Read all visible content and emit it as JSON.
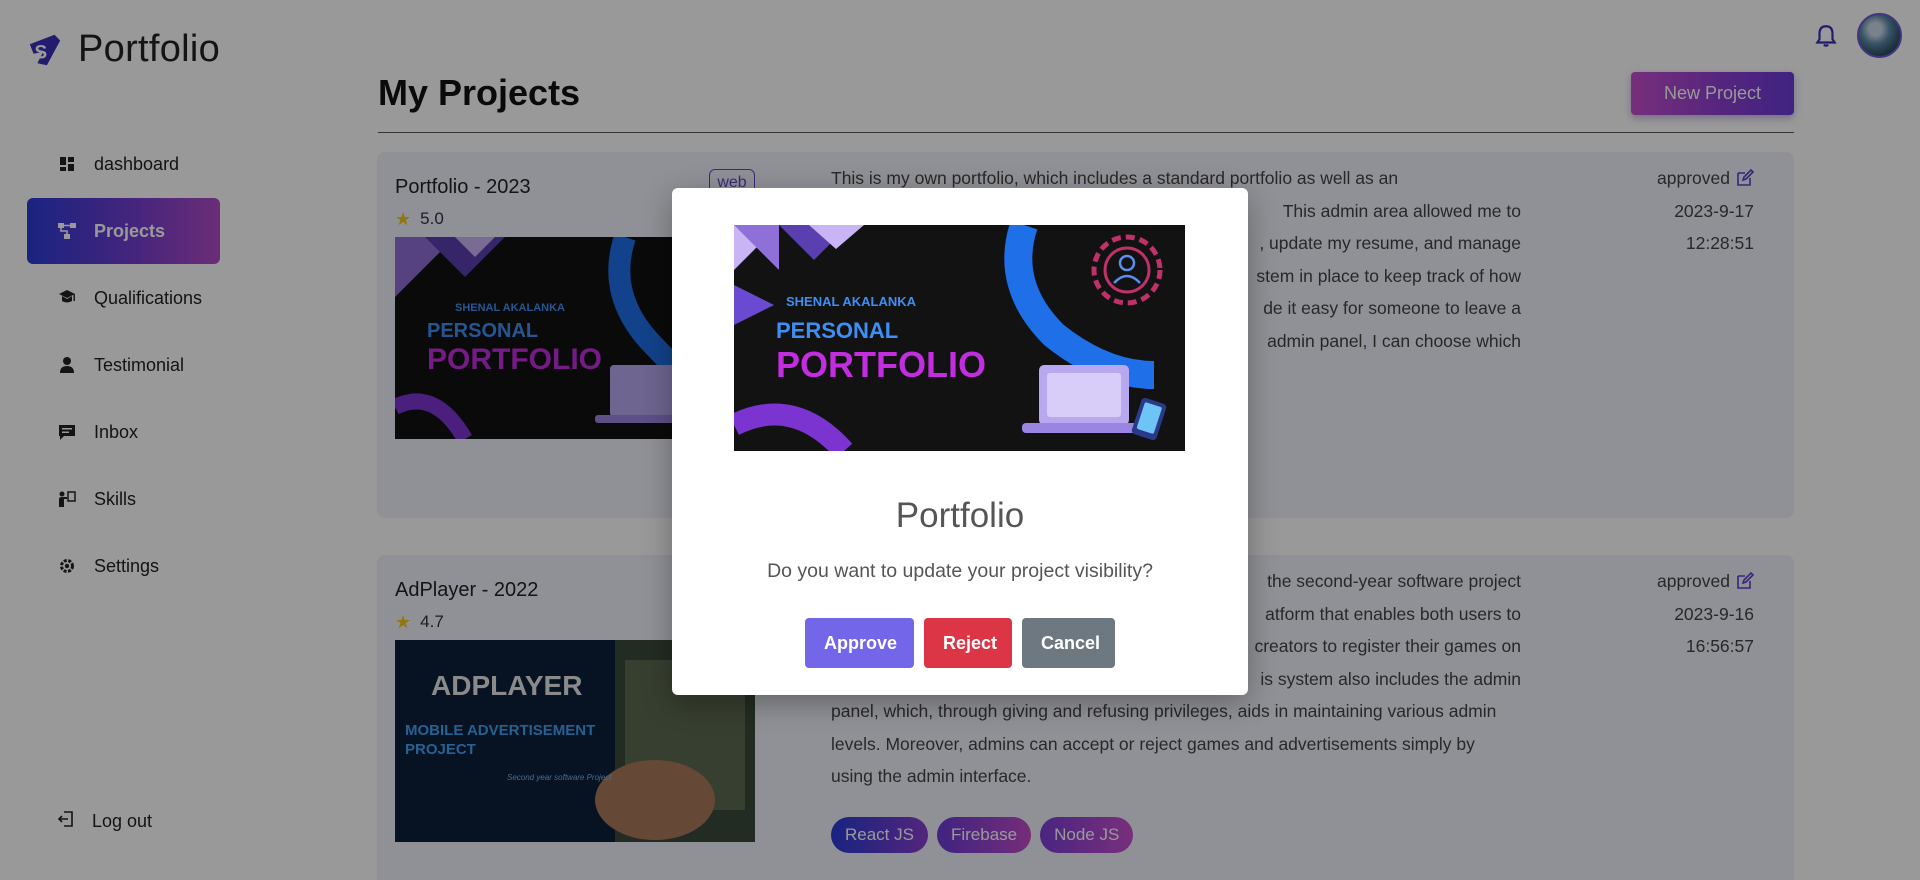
{
  "brand": {
    "name": "Portfolio",
    "logo_text": "S"
  },
  "sidebar": {
    "items": [
      {
        "label": "dashboard",
        "icon": "grid-icon"
      },
      {
        "label": "Projects",
        "icon": "nodes-icon",
        "active": true
      },
      {
        "label": "Qualifications",
        "icon": "graduation-cap-icon"
      },
      {
        "label": "Testimonial",
        "icon": "user-icon"
      },
      {
        "label": "Inbox",
        "icon": "chat-icon"
      },
      {
        "label": "Skills",
        "icon": "presenter-icon"
      },
      {
        "label": "Settings",
        "icon": "gear-icon"
      }
    ],
    "logout_label": "Log out"
  },
  "header": {
    "title": "My Projects",
    "new_button_label": "New Project"
  },
  "projects": [
    {
      "title": "Portfolio - 2023",
      "rating": "5.0",
      "tag": "web",
      "description_lines": [
        "This is my own portfolio, which includes a standard portfolio as well as an",
        "This admin area allowed me to",
        ", update my resume, and manage",
        "stem in place to keep track of how",
        "de it easy for someone to leave a",
        "admin panel, I can choose which"
      ],
      "status": "approved",
      "date": "2023-9-17",
      "time": "12:28:51",
      "thumbnail": {
        "author": "SHENAL AKALANKA",
        "line1": "PERSONAL",
        "line2": "PORTFOLIO"
      }
    },
    {
      "title": "AdPlayer - 2022",
      "rating": "4.7",
      "description_lines": [
        "the second-year software project",
        "atform that enables both users to",
        "creators to register their games on",
        "is system also includes the admin",
        "panel, which, through giving and refusing privileges, aids in maintaining various admin",
        "levels. Moreover, admins can accept or reject games and advertisements simply by",
        "using the admin interface."
      ],
      "status": "approved",
      "date": "2023-9-16",
      "time": "16:56:57",
      "technologies": [
        "React JS",
        "Firebase",
        "Node JS"
      ],
      "thumbnail": {
        "line1": "ADPLAYER",
        "line2": "MOBILE ADVERTISEMENT",
        "line3": "PROJECT",
        "caption": "Second year software Project"
      }
    }
  ],
  "modal": {
    "title": "Portfolio",
    "message": "Do you want to update your project visibility?",
    "approve_label": "Approve",
    "reject_label": "Reject",
    "cancel_label": "Cancel",
    "image": {
      "author": "SHENAL AKALANKA",
      "line1": "PERSONAL",
      "line2": "PORTFOLIO"
    }
  },
  "colors": {
    "accent": "#7366e8",
    "reject": "#dc3545",
    "cancel": "#6e7881",
    "active_nav_start": "#2a3bd6",
    "active_nav_end": "#b24cc7"
  }
}
